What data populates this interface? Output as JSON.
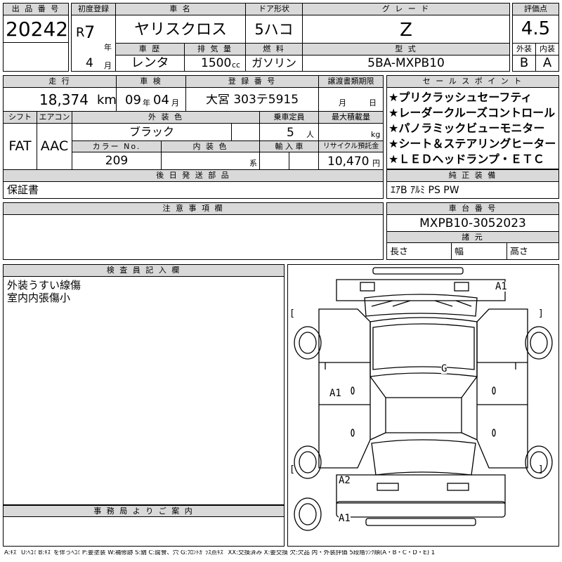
{
  "header": {
    "lot_label": "出 品 番 号",
    "lot_number": "20242",
    "first_reg_label": "初度登録",
    "era_letter": "R",
    "reg_year": "7",
    "year_unit": "年",
    "reg_month": "4",
    "month_unit": "月",
    "car_name_label": "車 名",
    "car_name": "ヤリスクロス",
    "door_label": "ドア形状",
    "door_type": "5ハコ",
    "grade_label": "グ レ ー ド",
    "grade": "Z",
    "score_label": "評価点",
    "score": "4.5",
    "history_label": "車 歴",
    "history": "レンタ",
    "displacement_label": "排 気 量",
    "displacement": "1500",
    "cc_unit": "cc",
    "fuel_label": "燃 料",
    "fuel": "ガソリン",
    "model_label": "型 式",
    "model_code": "5BA-MXPB10",
    "exterior_grade_label": "外装",
    "exterior_grade": "B",
    "interior_grade_label": "内装",
    "interior_grade": "A"
  },
  "details": {
    "mileage_label": "走 行",
    "mileage": "18,374",
    "mileage_unit": "km",
    "inspection_label": "車 検",
    "insp_year": "09",
    "insp_year_unit": "年",
    "insp_month": "04",
    "insp_month_unit": "月",
    "plate_label": "登 録 番 号",
    "plate": "大宮 303テ5915",
    "doc_period_label": "譲渡書類期限",
    "doc_month_unit": "月",
    "doc_day_unit": "日",
    "shift_label": "シフト",
    "shift": "FAT",
    "ac_label": "エアコン",
    "ac": "AAC",
    "color_label": "外 装 色",
    "color": "ブラック",
    "capacity_label": "乗車定員",
    "capacity": "5",
    "capacity_unit": "人",
    "load_label": "最大積載量",
    "load_unit": "kg",
    "color_no_label": "カラー No.",
    "color_no": "209",
    "interior_color_label": "内 装 色",
    "interior_color_unit": "系",
    "import_label": "輸 入 車",
    "recycle_label": "リサイクル預託金",
    "recycle": "10,470",
    "recycle_unit": "円",
    "later_parts_label": "後 日 発 送 部 品",
    "later_parts": "保証書"
  },
  "selling_points": {
    "label": "セ ー ル ス ポ イ ン ト",
    "items": [
      "★プリクラッシュセーフティ",
      "★レーダークルーズコントロール",
      "★パノラミックビューモニター",
      "★シート＆ステアリングヒーター",
      "★ＬＥＤヘッドランプ・ＥＴＣ"
    ]
  },
  "equipment": {
    "label": "純 正 装 備",
    "value": "ｴｱB ｱﾙﾐ PS PW"
  },
  "notes": {
    "label": "注 意 事 項 欄"
  },
  "chassis": {
    "label": "車 台 番 号",
    "number": "MXPB10-3052023",
    "spec_label": "諸 元",
    "length_label": "長さ",
    "width_label": "幅",
    "height_label": "高さ"
  },
  "inspector": {
    "label": "検 査 員 記 入 欄",
    "lines": [
      "外装うすい線傷",
      "室内内張傷小"
    ]
  },
  "office": {
    "label": "事 務 局 よ り ご 案 内"
  },
  "diagram": {
    "marks": [
      "A1",
      "G",
      "A1",
      "A2",
      "A1"
    ],
    "bracket_left_top": "[",
    "bracket_right_top": "]",
    "bracket_left_bottom": "[",
    "bracket_right_bottom": "]"
  },
  "footer": {
    "legend": "A:ｷｽﾞ U:ﾍｺﾐ B:ｷｽﾞを伴うﾍｺﾐ P:要塗装 W:補修跡 S:錆 C:腐食、穴 G:ﾌﾛﾝﾄｶﾞﾗｽ点ｷｽﾞ XX:交換済み X:要交換 欠:欠品 内・外装評価 5段階ﾗﾝｸ順(A・B・C・D・E) 1"
  }
}
